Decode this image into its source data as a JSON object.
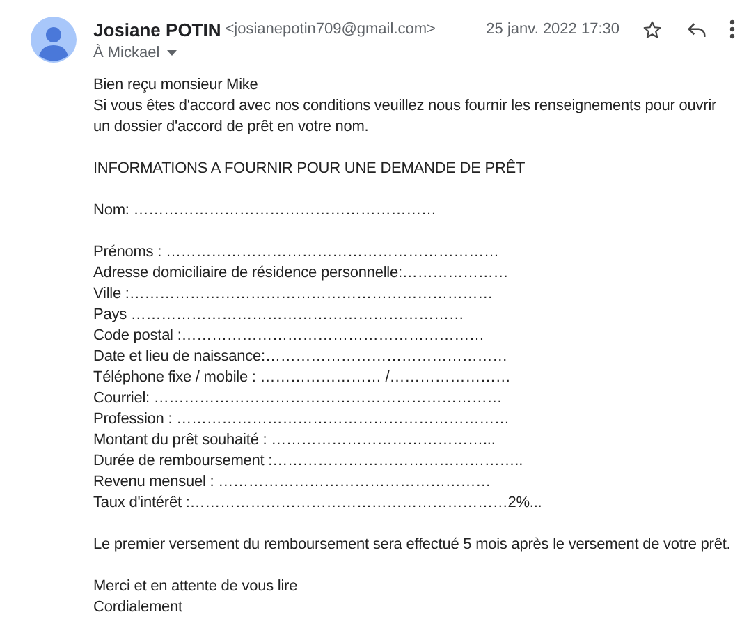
{
  "header": {
    "sender_name": "Josiane POTIN",
    "sender_email": "<josianepotin709@gmail.com>",
    "date": "25 janv. 2022 17:30",
    "recipient": "À Mickael"
  },
  "body": [
    [
      "Bien reçu monsieur Mike",
      "Si vous êtes d'accord avec nos conditions veuillez nous fournir les renseignements pour ouvrir un dossier d'accord de prêt en votre nom."
    ],
    [
      "INFORMATIONS A FOURNIR POUR UNE DEMANDE DE PRÊT"
    ],
    [
      "Nom: ……………………………………………………"
    ],
    [
      "Prénoms : …………………………………………………………",
      "Adresse domiciliaire de résidence personnelle:…………………",
      "Ville :………………………………………………………………",
      "Pays …………………………………………………………",
      "Code postal :……………………………………………………",
      "Date et lieu de naissance:…………………………………………",
      "Téléphone fixe / mobile : …………………… /……………………",
      "Courriel: ……………………………………………………………",
      "Profession : …………………………………………………………",
      "Montant du prêt souhaité : ……………………………………...",
      "Durée de remboursement :…………………………………………..",
      "Revenu mensuel : ………………………………………………",
      "Taux d'intérêt :………………………………………………………2%..."
    ],
    [
      "Le premier versement du remboursement sera effectué 5 mois après le versement de votre prêt."
    ],
    [
      "Merci et en attente de vous lire",
      "Cordialement"
    ]
  ]
}
